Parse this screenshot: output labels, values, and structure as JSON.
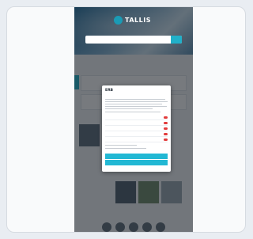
{
  "app": {
    "brand_name": "TALLIS",
    "search_placeholder": ""
  },
  "sections": {
    "section_1": "",
    "section_2": "",
    "section_3": ""
  },
  "consent": {
    "brand": "ERB",
    "title": "",
    "header_link": "",
    "options": [
      {
        "label": "",
        "enabled": true
      },
      {
        "label": "",
        "enabled": true
      },
      {
        "label": "",
        "enabled": true
      },
      {
        "label": "",
        "enabled": true
      },
      {
        "label": "",
        "enabled": true
      }
    ],
    "accept_all_label": "",
    "accept_selected_label": "",
    "save_label": ""
  },
  "colors": {
    "accent": "#22b8d4",
    "toggle_on": "#e23b3b",
    "scrim": "#14191f"
  }
}
